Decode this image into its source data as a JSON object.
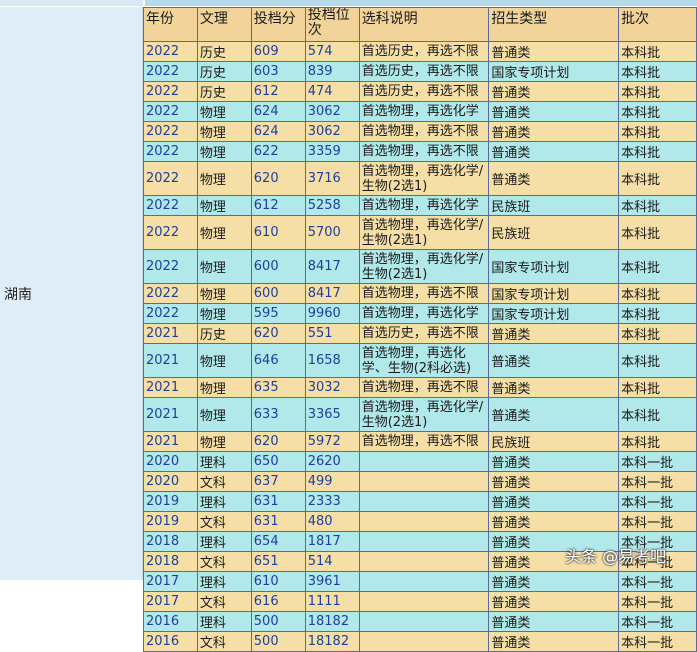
{
  "province": "湖南",
  "headers": [
    "年份",
    "文理",
    "投档分",
    "投档位次",
    "选科说明",
    "招生类型",
    "批次"
  ],
  "rows": [
    [
      "2022",
      "历史",
      "609",
      "574",
      "首选历史，再选不限",
      "普通类",
      "本科批"
    ],
    [
      "2022",
      "历史",
      "603",
      "839",
      "首选历史，再选不限",
      "国家专项计划",
      "本科批"
    ],
    [
      "2022",
      "历史",
      "612",
      "474",
      "首选历史，再选不限",
      "普通类",
      "本科批"
    ],
    [
      "2022",
      "物理",
      "624",
      "3062",
      "首选物理，再选化学",
      "普通类",
      "本科批"
    ],
    [
      "2022",
      "物理",
      "624",
      "3062",
      "首选物理，再选不限",
      "普通类",
      "本科批"
    ],
    [
      "2022",
      "物理",
      "622",
      "3359",
      "首选物理，再选不限",
      "普通类",
      "本科批"
    ],
    [
      "2022",
      "物理",
      "620",
      "3716",
      "首选物理，再选化学/生物(2选1)",
      "普通类",
      "本科批"
    ],
    [
      "2022",
      "物理",
      "612",
      "5258",
      "首选物理，再选化学",
      "民族班",
      "本科批"
    ],
    [
      "2022",
      "物理",
      "610",
      "5700",
      "首选物理，再选化学/生物(2选1)",
      "民族班",
      "本科批"
    ],
    [
      "2022",
      "物理",
      "600",
      "8417",
      "首选物理，再选化学/生物(2选1)",
      "国家专项计划",
      "本科批"
    ],
    [
      "2022",
      "物理",
      "600",
      "8417",
      "首选物理，再选不限",
      "国家专项计划",
      "本科批"
    ],
    [
      "2022",
      "物理",
      "595",
      "9960",
      "首选物理，再选化学",
      "国家专项计划",
      "本科批"
    ],
    [
      "2021",
      "历史",
      "620",
      "551",
      "首选历史，再选不限",
      "普通类",
      "本科批"
    ],
    [
      "2021",
      "物理",
      "646",
      "1658",
      "首选物理，再选化学、生物(2科必选)",
      "普通类",
      "本科批"
    ],
    [
      "2021",
      "物理",
      "635",
      "3032",
      "首选物理，再选不限",
      "普通类",
      "本科批"
    ],
    [
      "2021",
      "物理",
      "633",
      "3365",
      "首选物理，再选化学/生物(2选1)",
      "普通类",
      "本科批"
    ],
    [
      "2021",
      "物理",
      "620",
      "5972",
      "首选物理，再选不限",
      "民族班",
      "本科批"
    ],
    [
      "2020",
      "理科",
      "650",
      "2620",
      "",
      "普通类",
      "本科一批"
    ],
    [
      "2020",
      "文科",
      "637",
      "499",
      "",
      "普通类",
      "本科一批"
    ],
    [
      "2019",
      "理科",
      "631",
      "2333",
      "",
      "普通类",
      "本科一批"
    ],
    [
      "2019",
      "文科",
      "631",
      "480",
      "",
      "普通类",
      "本科一批"
    ],
    [
      "2018",
      "理科",
      "654",
      "1817",
      "",
      "普通类",
      "本科一批"
    ],
    [
      "2018",
      "文科",
      "651",
      "514",
      "",
      "普通类",
      "本科一批"
    ],
    [
      "2017",
      "理科",
      "610",
      "3961",
      "",
      "普通类",
      "本科一批"
    ],
    [
      "2017",
      "文科",
      "616",
      "1111",
      "",
      "普通类",
      "本科一批"
    ],
    [
      "2016",
      "理科",
      "500",
      "18182",
      "",
      "普通类",
      "本科一批"
    ],
    [
      "2016",
      "文科",
      "500",
      "18182",
      "",
      "普通类",
      "本科一批"
    ]
  ],
  "watermark": "头条 @易考吧",
  "colors": {
    "header": "#f2d49a",
    "row_yellow": "#f5dfa6",
    "row_cyan": "#b1e8ea",
    "border": "#5a6a9a"
  }
}
